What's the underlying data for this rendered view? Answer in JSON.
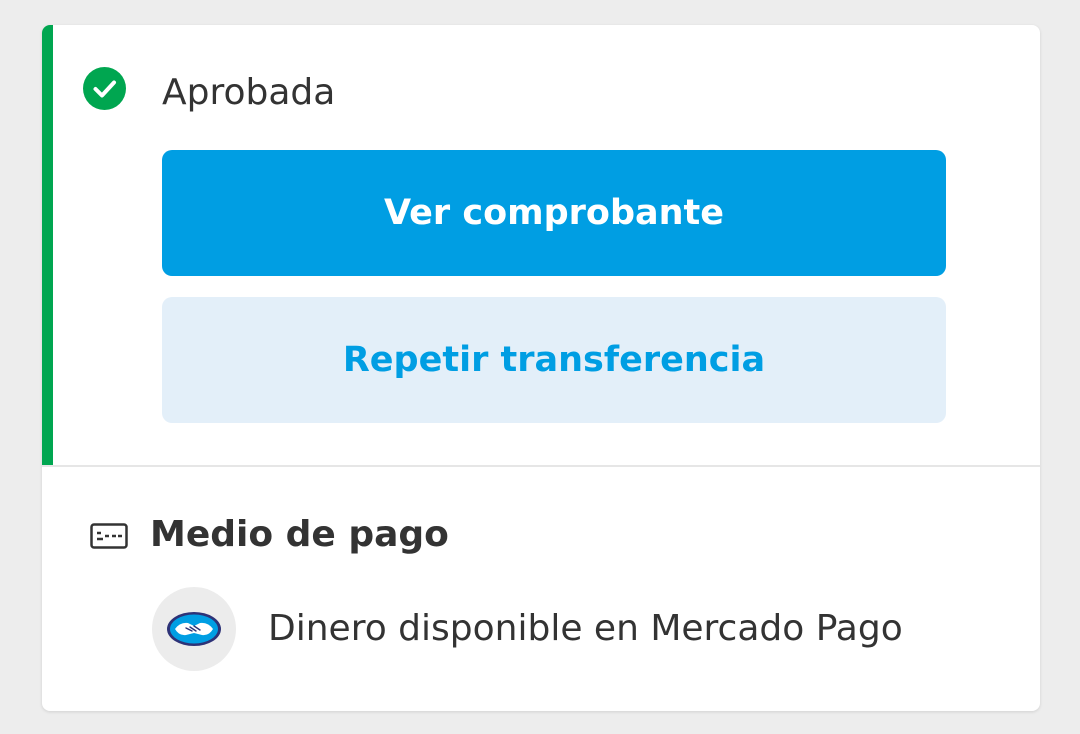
{
  "status": {
    "label": "Aprobada",
    "icon": "check-circle-icon",
    "color": "#00a650"
  },
  "actions": {
    "primary_label": "Ver comprobante",
    "secondary_label": "Repetir transferencia",
    "primary_color": "#009ee3",
    "secondary_bg": "#e3eff9"
  },
  "payment_method": {
    "section_title": "Medio de pago",
    "section_icon": "credit-card-icon",
    "method_icon": "mercado-pago-handshake-icon",
    "method_label": "Dinero disponible en Mercado Pago"
  }
}
